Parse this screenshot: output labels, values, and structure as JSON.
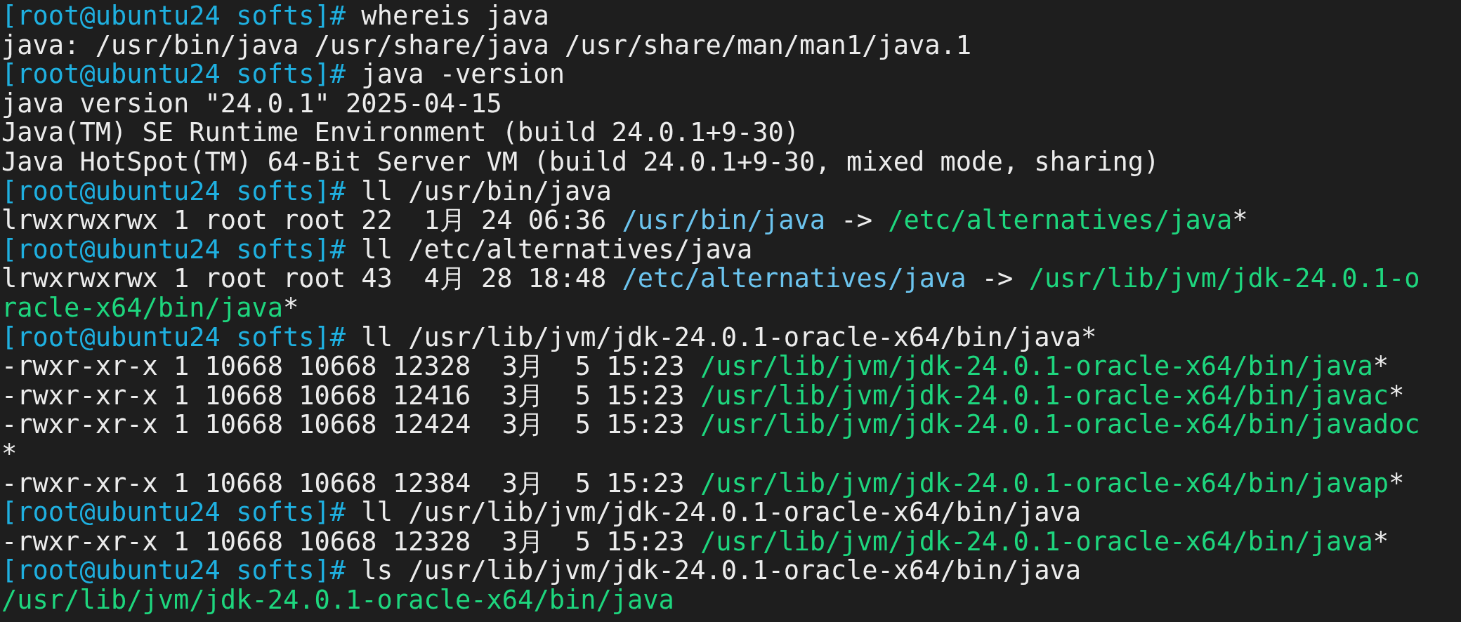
{
  "terminal": {
    "lines": [
      [
        {
          "kind": "prompt",
          "text": "[root@ubuntu24 softs]#"
        },
        {
          "kind": "command",
          "text": " whereis java"
        }
      ],
      [
        {
          "kind": "output",
          "text": "java: /usr/bin/java /usr/share/java /usr/share/man/man1/java.1"
        }
      ],
      [
        {
          "kind": "prompt",
          "text": "[root@ubuntu24 softs]#"
        },
        {
          "kind": "command",
          "text": " java -version"
        }
      ],
      [
        {
          "kind": "output",
          "text": "java version \"24.0.1\" 2025-04-15"
        }
      ],
      [
        {
          "kind": "output",
          "text": "Java(TM) SE Runtime Environment (build 24.0.1+9-30)"
        }
      ],
      [
        {
          "kind": "output",
          "text": "Java HotSpot(TM) 64-Bit Server VM (build 24.0.1+9-30, mixed mode, sharing)"
        }
      ],
      [
        {
          "kind": "prompt",
          "text": "[root@ubuntu24 softs]#"
        },
        {
          "kind": "command",
          "text": " ll /usr/bin/java"
        }
      ],
      [
        {
          "kind": "output",
          "text": "lrwxrwxrwx 1 root root 22  1月 24 06:36 "
        },
        {
          "kind": "link",
          "text": "/usr/bin/java"
        },
        {
          "kind": "output",
          "text": " -> "
        },
        {
          "kind": "exec",
          "text": "/etc/alternatives/java"
        },
        {
          "kind": "output",
          "text": "*"
        }
      ],
      [
        {
          "kind": "prompt",
          "text": "[root@ubuntu24 softs]#"
        },
        {
          "kind": "command",
          "text": " ll /etc/alternatives/java"
        }
      ],
      [
        {
          "kind": "output",
          "text": "lrwxrwxrwx 1 root root 43  4月 28 18:48 "
        },
        {
          "kind": "link",
          "text": "/etc/alternatives/java"
        },
        {
          "kind": "output",
          "text": " -> "
        },
        {
          "kind": "exec",
          "text": "/usr/lib/jvm/jdk-24.0.1-o"
        }
      ],
      [
        {
          "kind": "exec",
          "text": "racle-x64/bin/java"
        },
        {
          "kind": "output",
          "text": "*"
        }
      ],
      [
        {
          "kind": "prompt",
          "text": "[root@ubuntu24 softs]#"
        },
        {
          "kind": "command",
          "text": " ll /usr/lib/jvm/jdk-24.0.1-oracle-x64/bin/java*"
        }
      ],
      [
        {
          "kind": "output",
          "text": "-rwxr-xr-x 1 10668 10668 12328  3月  5 15:23 "
        },
        {
          "kind": "exec",
          "text": "/usr/lib/jvm/jdk-24.0.1-oracle-x64/bin/java"
        },
        {
          "kind": "output",
          "text": "*"
        }
      ],
      [
        {
          "kind": "output",
          "text": "-rwxr-xr-x 1 10668 10668 12416  3月  5 15:23 "
        },
        {
          "kind": "exec",
          "text": "/usr/lib/jvm/jdk-24.0.1-oracle-x64/bin/javac"
        },
        {
          "kind": "output",
          "text": "*"
        }
      ],
      [
        {
          "kind": "output",
          "text": "-rwxr-xr-x 1 10668 10668 12424  3月  5 15:23 "
        },
        {
          "kind": "exec",
          "text": "/usr/lib/jvm/jdk-24.0.1-oracle-x64/bin/javadoc"
        }
      ],
      [
        {
          "kind": "output",
          "text": "*"
        }
      ],
      [
        {
          "kind": "output",
          "text": "-rwxr-xr-x 1 10668 10668 12384  3月  5 15:23 "
        },
        {
          "kind": "exec",
          "text": "/usr/lib/jvm/jdk-24.0.1-oracle-x64/bin/javap"
        },
        {
          "kind": "output",
          "text": "*"
        }
      ],
      [
        {
          "kind": "prompt",
          "text": "[root@ubuntu24 softs]#"
        },
        {
          "kind": "command",
          "text": " ll /usr/lib/jvm/jdk-24.0.1-oracle-x64/bin/java"
        }
      ],
      [
        {
          "kind": "output",
          "text": "-rwxr-xr-x 1 10668 10668 12328  3月  5 15:23 "
        },
        {
          "kind": "exec",
          "text": "/usr/lib/jvm/jdk-24.0.1-oracle-x64/bin/java"
        },
        {
          "kind": "output",
          "text": "*"
        }
      ],
      [
        {
          "kind": "prompt",
          "text": "[root@ubuntu24 softs]#"
        },
        {
          "kind": "command",
          "text": " ls /usr/lib/jvm/jdk-24.0.1-oracle-x64/bin/java"
        }
      ],
      [
        {
          "kind": "exec",
          "text": "/usr/lib/jvm/jdk-24.0.1-oracle-x64/bin/java"
        }
      ]
    ]
  }
}
